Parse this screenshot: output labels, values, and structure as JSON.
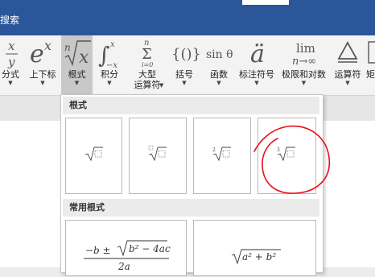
{
  "titlebar": {
    "search_text": "搜索"
  },
  "ribbon": {
    "buttons": [
      {
        "label": "分式",
        "glyph": "x/y"
      },
      {
        "label": "上下标",
        "glyph": "e^x"
      },
      {
        "label": "根式",
        "glyph": "ⁿ√x"
      },
      {
        "label": "积分",
        "glyph": "∫x"
      },
      {
        "label": "大型\n运算符",
        "glyph": "Σ"
      },
      {
        "label": "括号",
        "glyph": "{()}"
      },
      {
        "label": "函数",
        "glyph": "sin θ"
      },
      {
        "label": "标注符号",
        "glyph": "ä"
      },
      {
        "label": "极限和对数",
        "glyph": "lim n→∞"
      },
      {
        "label": "运算符",
        "glyph": "Δ"
      },
      {
        "label": "矩",
        "glyph": "[]"
      }
    ],
    "dropdown_arrow": "▼"
  },
  "gallery": {
    "section1": "根式",
    "section2": "常用根式",
    "radical_tiles": [
      "square-root",
      "root-with-degree",
      "square-root-with-degree-2",
      "cube-root"
    ],
    "formula1": {
      "numerator_left": "−b ± ",
      "numerator_radicand": "b² − 4ac",
      "denominator": "2a"
    },
    "formula2": {
      "radicand": "a² + b²"
    }
  }
}
